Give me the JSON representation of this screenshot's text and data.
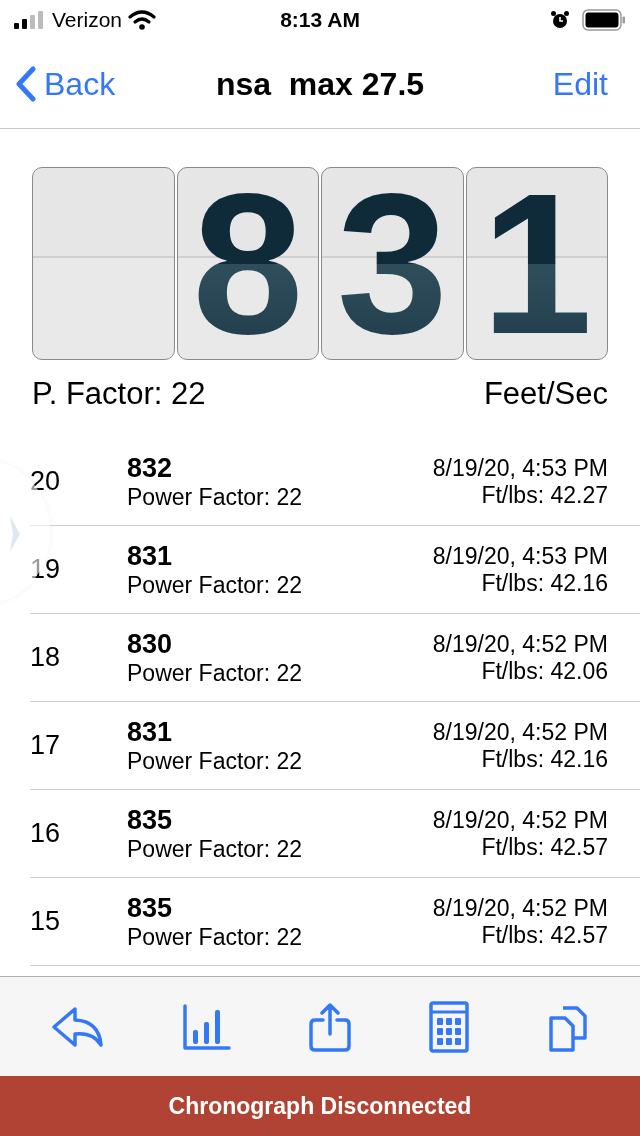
{
  "status_bar": {
    "carrier": "Verizon",
    "time": "8:13 AM"
  },
  "nav": {
    "back": "Back",
    "title": "nsa  max 27.5",
    "edit": "Edit"
  },
  "display": {
    "digits": [
      "8",
      "3",
      "1"
    ],
    "factor": "P. Factor: 22",
    "unit": "Feet/Sec"
  },
  "shots": [
    {
      "index": "20",
      "velocity": "832",
      "factor": "Power Factor: 22",
      "time": "8/19/20, 4:53 PM",
      "energy": "Ft/lbs: 42.27"
    },
    {
      "index": "19",
      "velocity": "831",
      "factor": "Power Factor: 22",
      "time": "8/19/20, 4:53 PM",
      "energy": "Ft/lbs: 42.16"
    },
    {
      "index": "18",
      "velocity": "830",
      "factor": "Power Factor: 22",
      "time": "8/19/20, 4:52 PM",
      "energy": "Ft/lbs: 42.06"
    },
    {
      "index": "17",
      "velocity": "831",
      "factor": "Power Factor: 22",
      "time": "8/19/20, 4:52 PM",
      "energy": "Ft/lbs: 42.16"
    },
    {
      "index": "16",
      "velocity": "835",
      "factor": "Power Factor: 22",
      "time": "8/19/20, 4:52 PM",
      "energy": "Ft/lbs: 42.57"
    },
    {
      "index": "15",
      "velocity": "835",
      "factor": "Power Factor: 22",
      "time": "8/19/20, 4:52 PM",
      "energy": "Ft/lbs: 42.57"
    }
  ],
  "banner": "Chronograph Disconnected"
}
